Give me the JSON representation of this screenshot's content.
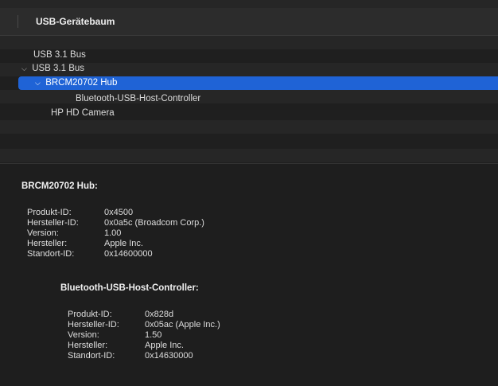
{
  "header": {
    "title": "USB-Gerätebaum"
  },
  "tree": {
    "rows": [
      {
        "label": "USB 3.1 Bus",
        "chevron": ""
      },
      {
        "label": "USB 3.1 Bus",
        "chevron": "⌵"
      },
      {
        "label": "BRCM20702 Hub",
        "chevron": "⌵",
        "selected": true
      },
      {
        "label": "Bluetooth-USB-Host-Controller",
        "chevron": ""
      },
      {
        "label": "HP HD Camera",
        "chevron": ""
      }
    ]
  },
  "details": {
    "hub": {
      "title": "BRCM20702 Hub:",
      "fields": [
        {
          "key": "Produkt-ID:",
          "value": "0x4500"
        },
        {
          "key": "Hersteller-ID:",
          "value": "0x0a5c  (Broadcom Corp.)"
        },
        {
          "key": "Version:",
          "value": "1.00"
        },
        {
          "key": "Hersteller:",
          "value": "Apple Inc."
        },
        {
          "key": "Standort-ID:",
          "value": "0x14600000"
        }
      ]
    },
    "bluetooth": {
      "title": "Bluetooth-USB-Host-Controller:",
      "fields": [
        {
          "key": "Produkt-ID:",
          "value": "0x828d"
        },
        {
          "key": "Hersteller-ID:",
          "value": "0x05ac (Apple Inc.)"
        },
        {
          "key": "Version:",
          "value": "1.50"
        },
        {
          "key": "Hersteller:",
          "value": "Apple Inc."
        },
        {
          "key": "Standort-ID:",
          "value": "0x14630000"
        }
      ]
    }
  },
  "colors": {
    "selection": "#1f63d6",
    "background": "#1e1e1e"
  }
}
